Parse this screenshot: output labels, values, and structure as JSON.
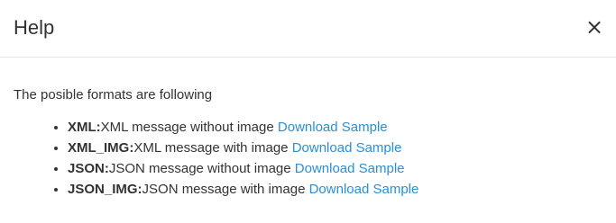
{
  "modal": {
    "title": "Help",
    "close_glyph": "×",
    "close_icon": "close-icon"
  },
  "body": {
    "intro": "The posible formats are following",
    "formats": [
      {
        "name": "XML:",
        "description": "XML message without image",
        "link": "Download Sample"
      },
      {
        "name": "XML_IMG:",
        "description": "XML message with image",
        "link": "Download Sample"
      },
      {
        "name": "JSON:",
        "description": "JSON message without image",
        "link": "Download Sample"
      },
      {
        "name": "JSON_IMG:",
        "description": "JSON message with image",
        "link": "Download Sample"
      }
    ]
  },
  "colors": {
    "link": "#2a8fd8",
    "text": "#333333",
    "divider": "#e5e5e5"
  }
}
